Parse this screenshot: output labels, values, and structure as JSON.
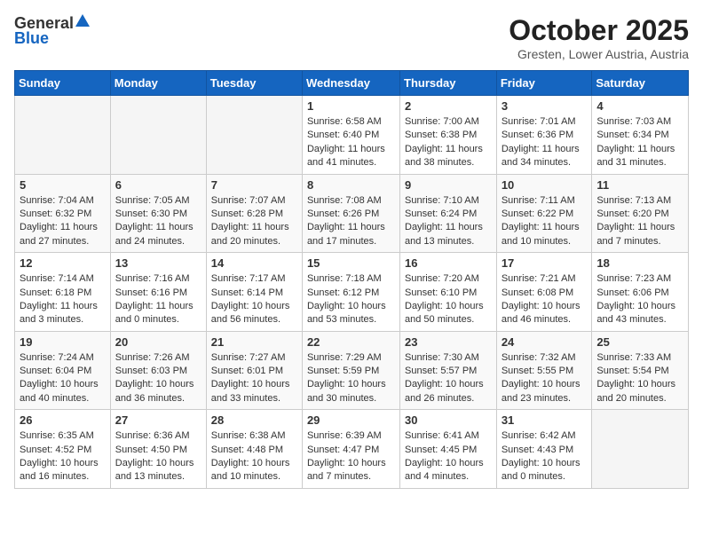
{
  "header": {
    "logo_general": "General",
    "logo_blue": "Blue",
    "month": "October 2025",
    "location": "Gresten, Lower Austria, Austria"
  },
  "weekdays": [
    "Sunday",
    "Monday",
    "Tuesday",
    "Wednesday",
    "Thursday",
    "Friday",
    "Saturday"
  ],
  "weeks": [
    [
      {
        "day": "",
        "info": ""
      },
      {
        "day": "",
        "info": ""
      },
      {
        "day": "",
        "info": ""
      },
      {
        "day": "1",
        "info": "Sunrise: 6:58 AM\nSunset: 6:40 PM\nDaylight: 11 hours\nand 41 minutes."
      },
      {
        "day": "2",
        "info": "Sunrise: 7:00 AM\nSunset: 6:38 PM\nDaylight: 11 hours\nand 38 minutes."
      },
      {
        "day": "3",
        "info": "Sunrise: 7:01 AM\nSunset: 6:36 PM\nDaylight: 11 hours\nand 34 minutes."
      },
      {
        "day": "4",
        "info": "Sunrise: 7:03 AM\nSunset: 6:34 PM\nDaylight: 11 hours\nand 31 minutes."
      }
    ],
    [
      {
        "day": "5",
        "info": "Sunrise: 7:04 AM\nSunset: 6:32 PM\nDaylight: 11 hours\nand 27 minutes."
      },
      {
        "day": "6",
        "info": "Sunrise: 7:05 AM\nSunset: 6:30 PM\nDaylight: 11 hours\nand 24 minutes."
      },
      {
        "day": "7",
        "info": "Sunrise: 7:07 AM\nSunset: 6:28 PM\nDaylight: 11 hours\nand 20 minutes."
      },
      {
        "day": "8",
        "info": "Sunrise: 7:08 AM\nSunset: 6:26 PM\nDaylight: 11 hours\nand 17 minutes."
      },
      {
        "day": "9",
        "info": "Sunrise: 7:10 AM\nSunset: 6:24 PM\nDaylight: 11 hours\nand 13 minutes."
      },
      {
        "day": "10",
        "info": "Sunrise: 7:11 AM\nSunset: 6:22 PM\nDaylight: 11 hours\nand 10 minutes."
      },
      {
        "day": "11",
        "info": "Sunrise: 7:13 AM\nSunset: 6:20 PM\nDaylight: 11 hours\nand 7 minutes."
      }
    ],
    [
      {
        "day": "12",
        "info": "Sunrise: 7:14 AM\nSunset: 6:18 PM\nDaylight: 11 hours\nand 3 minutes."
      },
      {
        "day": "13",
        "info": "Sunrise: 7:16 AM\nSunset: 6:16 PM\nDaylight: 11 hours\nand 0 minutes."
      },
      {
        "day": "14",
        "info": "Sunrise: 7:17 AM\nSunset: 6:14 PM\nDaylight: 10 hours\nand 56 minutes."
      },
      {
        "day": "15",
        "info": "Sunrise: 7:18 AM\nSunset: 6:12 PM\nDaylight: 10 hours\nand 53 minutes."
      },
      {
        "day": "16",
        "info": "Sunrise: 7:20 AM\nSunset: 6:10 PM\nDaylight: 10 hours\nand 50 minutes."
      },
      {
        "day": "17",
        "info": "Sunrise: 7:21 AM\nSunset: 6:08 PM\nDaylight: 10 hours\nand 46 minutes."
      },
      {
        "day": "18",
        "info": "Sunrise: 7:23 AM\nSunset: 6:06 PM\nDaylight: 10 hours\nand 43 minutes."
      }
    ],
    [
      {
        "day": "19",
        "info": "Sunrise: 7:24 AM\nSunset: 6:04 PM\nDaylight: 10 hours\nand 40 minutes."
      },
      {
        "day": "20",
        "info": "Sunrise: 7:26 AM\nSunset: 6:03 PM\nDaylight: 10 hours\nand 36 minutes."
      },
      {
        "day": "21",
        "info": "Sunrise: 7:27 AM\nSunset: 6:01 PM\nDaylight: 10 hours\nand 33 minutes."
      },
      {
        "day": "22",
        "info": "Sunrise: 7:29 AM\nSunset: 5:59 PM\nDaylight: 10 hours\nand 30 minutes."
      },
      {
        "day": "23",
        "info": "Sunrise: 7:30 AM\nSunset: 5:57 PM\nDaylight: 10 hours\nand 26 minutes."
      },
      {
        "day": "24",
        "info": "Sunrise: 7:32 AM\nSunset: 5:55 PM\nDaylight: 10 hours\nand 23 minutes."
      },
      {
        "day": "25",
        "info": "Sunrise: 7:33 AM\nSunset: 5:54 PM\nDaylight: 10 hours\nand 20 minutes."
      }
    ],
    [
      {
        "day": "26",
        "info": "Sunrise: 6:35 AM\nSunset: 4:52 PM\nDaylight: 10 hours\nand 16 minutes."
      },
      {
        "day": "27",
        "info": "Sunrise: 6:36 AM\nSunset: 4:50 PM\nDaylight: 10 hours\nand 13 minutes."
      },
      {
        "day": "28",
        "info": "Sunrise: 6:38 AM\nSunset: 4:48 PM\nDaylight: 10 hours\nand 10 minutes."
      },
      {
        "day": "29",
        "info": "Sunrise: 6:39 AM\nSunset: 4:47 PM\nDaylight: 10 hours\nand 7 minutes."
      },
      {
        "day": "30",
        "info": "Sunrise: 6:41 AM\nSunset: 4:45 PM\nDaylight: 10 hours\nand 4 minutes."
      },
      {
        "day": "31",
        "info": "Sunrise: 6:42 AM\nSunset: 4:43 PM\nDaylight: 10 hours\nand 0 minutes."
      },
      {
        "day": "",
        "info": ""
      }
    ]
  ]
}
